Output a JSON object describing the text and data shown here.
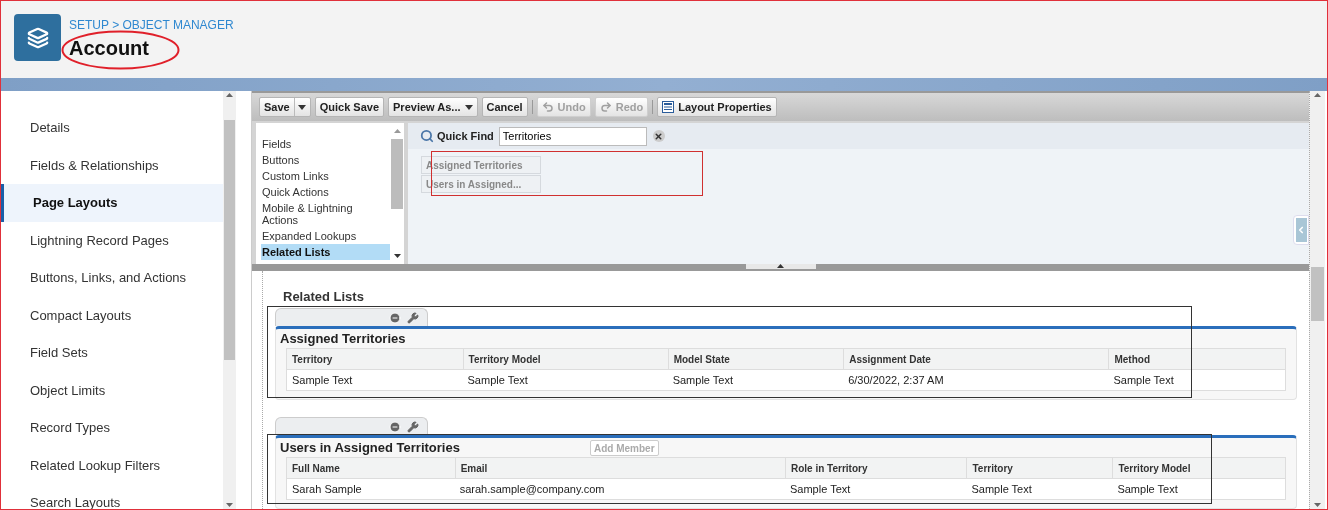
{
  "breadcrumb": "SETUP > OBJECT MANAGER",
  "title": "Account",
  "sidebar": {
    "items": [
      {
        "label": "Details",
        "selected": false
      },
      {
        "label": "Fields & Relationships",
        "selected": false
      },
      {
        "label": "Page Layouts",
        "selected": true
      },
      {
        "label": "Lightning Record Pages",
        "selected": false
      },
      {
        "label": "Buttons, Links, and Actions",
        "selected": false
      },
      {
        "label": "Compact Layouts",
        "selected": false
      },
      {
        "label": "Field Sets",
        "selected": false
      },
      {
        "label": "Object Limits",
        "selected": false
      },
      {
        "label": "Record Types",
        "selected": false
      },
      {
        "label": "Related Lookup Filters",
        "selected": false
      },
      {
        "label": "Search Layouts",
        "selected": false
      }
    ]
  },
  "toolbar": {
    "buttons": [
      {
        "label": "Save",
        "kind": "split",
        "disabled": false
      },
      {
        "label": "Quick Save",
        "kind": "plain",
        "disabled": false
      },
      {
        "label": "Preview As...",
        "kind": "dropdown",
        "disabled": false
      },
      {
        "label": "Cancel",
        "kind": "plain",
        "disabled": false
      },
      {
        "label": "Undo",
        "kind": "undo",
        "disabled": true
      },
      {
        "label": "Redo",
        "kind": "redo",
        "disabled": true
      },
      {
        "label": "Layout Properties",
        "kind": "properties",
        "disabled": false
      }
    ]
  },
  "palette": {
    "categories": [
      {
        "label": "Fields",
        "selected": false
      },
      {
        "label": "Buttons",
        "selected": false
      },
      {
        "label": "Custom Links",
        "selected": false
      },
      {
        "label": "Quick Actions",
        "selected": false
      },
      {
        "label": "Mobile & Lightning Actions",
        "selected": false
      },
      {
        "label": "Expanded Lookups",
        "selected": false
      },
      {
        "label": "Related Lists",
        "selected": true
      }
    ],
    "quick_find": {
      "label": "Quick Find",
      "value": "Territories"
    },
    "results": [
      "Assigned Territories",
      "Users in Assigned..."
    ]
  },
  "layout": {
    "section_title": "Related Lists",
    "related_lists": [
      {
        "title": "Assigned Territories",
        "columns": [
          "Territory",
          "Territory Model",
          "Model State",
          "Assignment Date",
          "Method"
        ],
        "rows": [
          [
            "Sample Text",
            "Sample Text",
            "Sample Text",
            "6/30/2022, 2:37 AM",
            "Sample Text"
          ]
        ]
      },
      {
        "title": "Users in Assigned Territories",
        "action": "Add Member",
        "columns": [
          "Full Name",
          "Email",
          "Role in Territory",
          "Territory",
          "Territory Model"
        ],
        "rows": [
          [
            "Sarah Sample",
            "sarah.sample@company.com",
            "Sample Text",
            "Sample Text",
            "Sample Text"
          ]
        ]
      }
    ]
  }
}
